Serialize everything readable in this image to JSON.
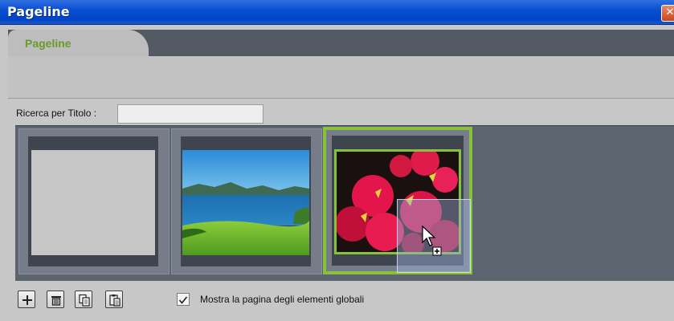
{
  "window": {
    "title": "Pageline",
    "close_symbol": "✕"
  },
  "tabs": [
    {
      "label": "Pageline",
      "active": true
    }
  ],
  "search": {
    "label": "Ricerca per Titolo :",
    "value": "",
    "placeholder": ""
  },
  "pages": [
    {
      "name": "page-blank",
      "image": "blank",
      "selected": false
    },
    {
      "name": "page-lake-landscape",
      "image": "lake-landscape",
      "selected": false
    },
    {
      "name": "page-red-flowers",
      "image": "red-flowers",
      "selected": true
    }
  ],
  "toolbar": {
    "buttons": [
      {
        "name": "add-page-button",
        "icon": "plus-icon"
      },
      {
        "name": "delete-page-button",
        "icon": "trash-icon"
      },
      {
        "name": "copy-page-button",
        "icon": "copy-icon"
      },
      {
        "name": "paste-page-button",
        "icon": "paste-icon"
      }
    ]
  },
  "global_elements": {
    "label": "Mostra la pagina degli elementi globali",
    "checked": true
  },
  "colors": {
    "accent": "#88c23a",
    "tab_label": "#6a9a2a",
    "titlebar": "#0a4fd0"
  }
}
